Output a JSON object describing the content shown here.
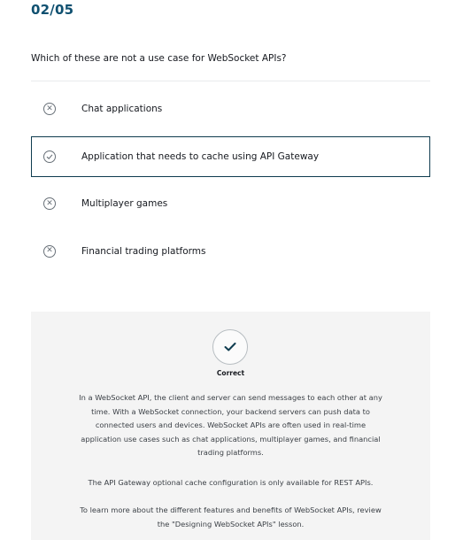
{
  "quiz": {
    "progress": "02/05",
    "question": "Which of these are not a use case for WebSocket APIs?",
    "options": [
      {
        "label": "Chat applications",
        "icon": "x-circle-icon",
        "selected": false
      },
      {
        "label": "Application that needs to cache using API Gateway",
        "icon": "check-circle-icon",
        "selected": true
      },
      {
        "label": "Multiplayer games",
        "icon": "x-circle-icon",
        "selected": false
      },
      {
        "label": "Financial trading platforms",
        "icon": "x-circle-icon",
        "selected": false
      }
    ]
  },
  "feedback": {
    "icon": "checkmark-icon",
    "status": "Correct",
    "paragraphs": [
      "In a WebSocket API, the client and server can send messages to each other at any time. With a WebSocket connection, your backend servers can push data to connected users and devices. WebSocket APIs are often used in real-time application use cases such as chat applications, multiplayer games, and financial trading platforms.",
      "The API Gateway optional cache configuration is only available for REST APIs.",
      "To learn more about the different features and benefits of WebSocket APIs, review the \"Designing WebSocket APIs\" lesson."
    ]
  },
  "colors": {
    "accent": "#0f5070",
    "selected_border": "#0f3c4f",
    "feedback_bg": "#f4f4f4",
    "checkmark": "#0f3c4f"
  }
}
